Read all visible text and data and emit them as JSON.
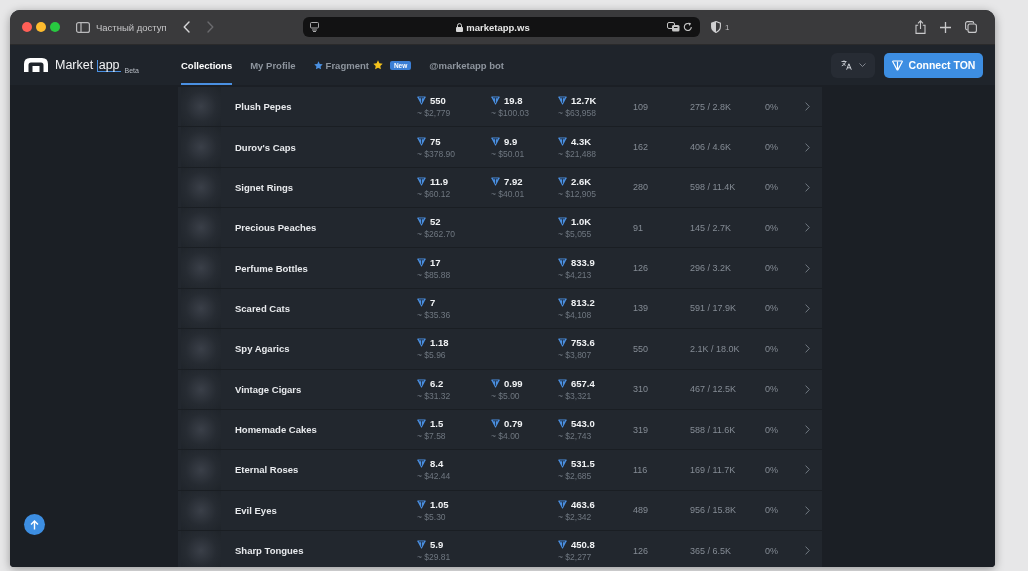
{
  "browser": {
    "private_label": "Частный доступ",
    "back": {
      "disabled": false
    },
    "forward": {
      "disabled": true
    },
    "url": "marketapp.ws",
    "shield_count": "1"
  },
  "header": {
    "logo": {
      "name": "Market",
      "accent": "app",
      "badge": "Beta"
    },
    "nav_tabs": [
      {
        "label": "Collections",
        "selected": true,
        "kind": "plain"
      },
      {
        "label": "My Profile",
        "selected": false,
        "kind": "plain"
      },
      {
        "label": "Fragment",
        "selected": false,
        "kind": "starred",
        "badge": "New"
      },
      {
        "label": "@marketapp bot",
        "selected": false,
        "kind": "plain"
      }
    ],
    "connect_button": {
      "label": "Connect TON"
    }
  },
  "collections": {
    "rows": [
      {
        "name": "Plush Pepes",
        "column_2": {
          "amount": "550",
          "usd": "~ $2,779"
        },
        "column_3": {
          "amount": "19.8",
          "usd": "~ $100.03"
        },
        "column_4": {
          "amount": "12.7K",
          "usd": "~ $63,958"
        },
        "column_5": "109",
        "column_6": "275 / 2.8K",
        "column_7": "0%"
      },
      {
        "name": "Durov's Caps",
        "column_2": {
          "amount": "75",
          "usd": "~ $378.90"
        },
        "column_3": {
          "amount": "9.9",
          "usd": "~ $50.01"
        },
        "column_4": {
          "amount": "4.3K",
          "usd": "~ $21,488"
        },
        "column_5": "162",
        "column_6": "406 / 4.6K",
        "column_7": "0%"
      },
      {
        "name": "Signet Rings",
        "column_2": {
          "amount": "11.9",
          "usd": "~ $60.12"
        },
        "column_3": {
          "amount": "7.92",
          "usd": "~ $40.01"
        },
        "column_4": {
          "amount": "2.6K",
          "usd": "~ $12,905"
        },
        "column_5": "280",
        "column_6": "598 / 11.4K",
        "column_7": "0%"
      },
      {
        "name": "Precious Peaches",
        "column_2": {
          "amount": "52",
          "usd": "~ $262.70"
        },
        "column_4": {
          "amount": "1.0K",
          "usd": "~ $5,055"
        },
        "column_5": "91",
        "column_6": "145 / 2.7K",
        "column_7": "0%"
      },
      {
        "name": "Perfume Bottles",
        "column_2": {
          "amount": "17",
          "usd": "~ $85.88"
        },
        "column_4": {
          "amount": "833.9",
          "usd": "~ $4,213"
        },
        "column_5": "126",
        "column_6": "296 / 3.2K",
        "column_7": "0%"
      },
      {
        "name": "Scared Cats",
        "column_2": {
          "amount": "7",
          "usd": "~ $35.36"
        },
        "column_4": {
          "amount": "813.2",
          "usd": "~ $4,108"
        },
        "column_5": "139",
        "column_6": "591 / 17.9K",
        "column_7": "0%"
      },
      {
        "name": "Spy Agarics",
        "column_2": {
          "amount": "1.18",
          "usd": "~ $5.96"
        },
        "column_4": {
          "amount": "753.6",
          "usd": "~ $3,807"
        },
        "column_5": "550",
        "column_6": "2.1K / 18.0K",
        "column_7": "0%"
      },
      {
        "name": "Vintage Cigars",
        "column_2": {
          "amount": "6.2",
          "usd": "~ $31.32"
        },
        "column_3": {
          "amount": "0.99",
          "usd": "~ $5.00"
        },
        "column_4": {
          "amount": "657.4",
          "usd": "~ $3,321"
        },
        "column_5": "310",
        "column_6": "467 / 12.5K",
        "column_7": "0%"
      },
      {
        "name": "Homemade Cakes",
        "column_2": {
          "amount": "1.5",
          "usd": "~ $7.58"
        },
        "column_3": {
          "amount": "0.79",
          "usd": "~ $4.00"
        },
        "column_4": {
          "amount": "543.0",
          "usd": "~ $2,743"
        },
        "column_5": "319",
        "column_6": "588 / 11.6K",
        "column_7": "0%"
      },
      {
        "name": "Eternal Roses",
        "column_2": {
          "amount": "8.4",
          "usd": "~ $42.44"
        },
        "column_4": {
          "amount": "531.5",
          "usd": "~ $2,685"
        },
        "column_5": "116",
        "column_6": "169 / 11.7K",
        "column_7": "0%"
      },
      {
        "name": "Evil Eyes",
        "column_2": {
          "amount": "1.05",
          "usd": "~ $5.30"
        },
        "column_4": {
          "amount": "463.6",
          "usd": "~ $2,342"
        },
        "column_5": "489",
        "column_6": "956 / 15.8K",
        "column_7": "0%"
      },
      {
        "name": "Sharp Tongues",
        "column_2": {
          "amount": "5.9",
          "usd": "~ $29.81"
        },
        "column_4": {
          "amount": "450.8",
          "usd": "~ $2,277"
        },
        "column_5": "126",
        "column_6": "365 / 6.5K",
        "column_7": "0%"
      }
    ]
  }
}
